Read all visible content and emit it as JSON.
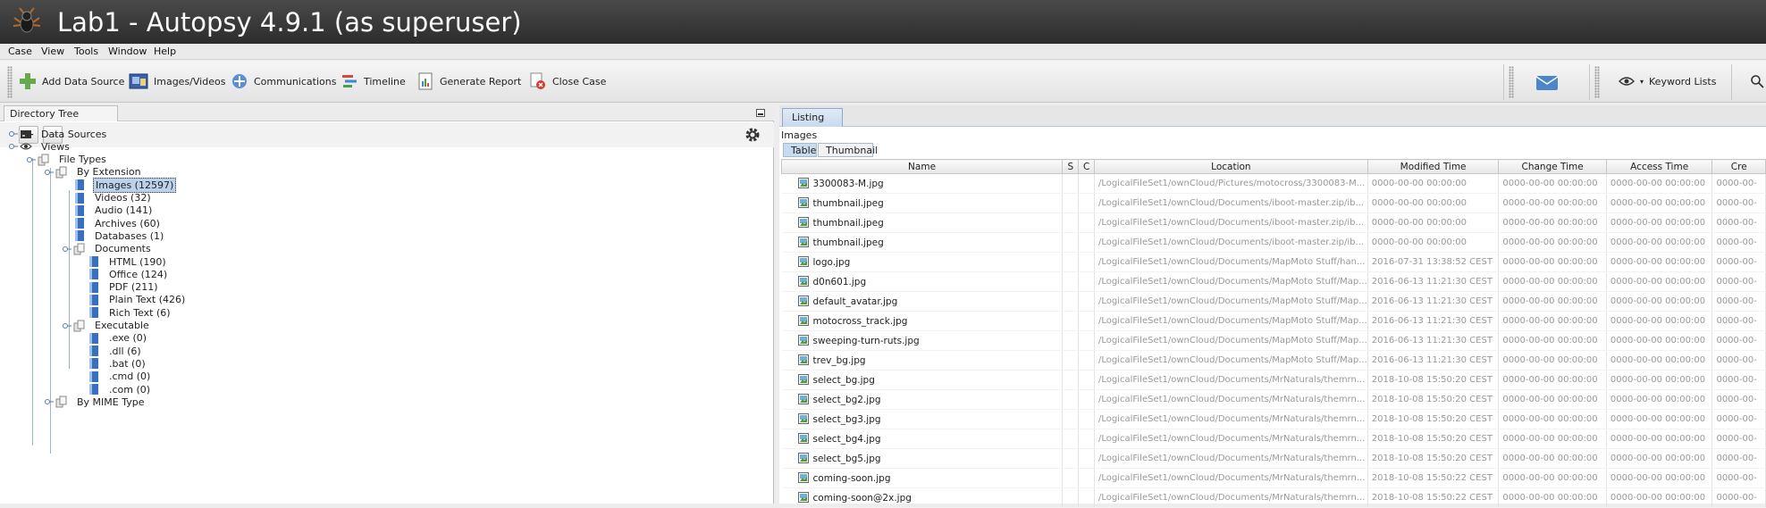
{
  "window": {
    "title": "Lab1 - Autopsy 4.9.1 (as superuser)"
  },
  "menubar": [
    "Case",
    "View",
    "Tools",
    "Window",
    "Help"
  ],
  "toolbar": {
    "add_data_source": "Add Data Source",
    "images_videos": "Images/Videos",
    "communications": "Communications",
    "timeline": "Timeline",
    "generate_report": "Generate Report",
    "close_case": "Close Case",
    "keyword_lists": "Keyword Lists"
  },
  "left_panel": {
    "tab": "Directory Tree",
    "tree": [
      {
        "label": "Data Sources",
        "depth": 0
      },
      {
        "label": "Views",
        "depth": 0
      },
      {
        "label": "File Types",
        "depth": 1
      },
      {
        "label": "By Extension",
        "depth": 2
      },
      {
        "label": "Images (12597)",
        "depth": 3,
        "selected": true
      },
      {
        "label": "Videos (32)",
        "depth": 3
      },
      {
        "label": "Audio (141)",
        "depth": 3
      },
      {
        "label": "Archives (60)",
        "depth": 3
      },
      {
        "label": "Databases (1)",
        "depth": 3
      },
      {
        "label": "Documents",
        "depth": 3
      },
      {
        "label": "HTML (190)",
        "depth": 4
      },
      {
        "label": "Office (124)",
        "depth": 4
      },
      {
        "label": "PDF (211)",
        "depth": 4
      },
      {
        "label": "Plain Text (426)",
        "depth": 4
      },
      {
        "label": "Rich Text (6)",
        "depth": 4
      },
      {
        "label": "Executable",
        "depth": 3
      },
      {
        "label": ".exe (0)",
        "depth": 4
      },
      {
        "label": ".dll (6)",
        "depth": 4
      },
      {
        "label": ".bat (0)",
        "depth": 4
      },
      {
        "label": ".cmd (0)",
        "depth": 4
      },
      {
        "label": ".com (0)",
        "depth": 4
      },
      {
        "label": "By MIME Type",
        "depth": 2
      }
    ]
  },
  "right_panel": {
    "tab": "Listing",
    "section_label": "Images",
    "subtabs": [
      "Table",
      "Thumbnail"
    ],
    "columns": [
      "Name",
      "S",
      "C",
      "Location",
      "Modified Time",
      "Change Time",
      "Access Time",
      "Cre"
    ],
    "rows": [
      {
        "name": "3300083-M.jpg",
        "location": "/LogicalFileSet1/ownCloud/Pictures/motocross/3300083-M...",
        "modified": "0000-00-00 00:00:00",
        "changed": "0000-00-00 00:00:00",
        "accessed": "0000-00-00 00:00:00",
        "created": "0000-00-"
      },
      {
        "name": "thumbnail.jpeg",
        "location": "/LogicalFileSet1/ownCloud/Documents/iboot-master.zip/ib...",
        "modified": "0000-00-00 00:00:00",
        "changed": "0000-00-00 00:00:00",
        "accessed": "0000-00-00 00:00:00",
        "created": "0000-00-"
      },
      {
        "name": "thumbnail.jpeg",
        "location": "/LogicalFileSet1/ownCloud/Documents/iboot-master.zip/ib...",
        "modified": "0000-00-00 00:00:00",
        "changed": "0000-00-00 00:00:00",
        "accessed": "0000-00-00 00:00:00",
        "created": "0000-00-"
      },
      {
        "name": "thumbnail.jpeg",
        "location": "/LogicalFileSet1/ownCloud/Documents/iboot-master.zip/ib...",
        "modified": "0000-00-00 00:00:00",
        "changed": "0000-00-00 00:00:00",
        "accessed": "0000-00-00 00:00:00",
        "created": "0000-00-"
      },
      {
        "name": "logo.jpg",
        "location": "/LogicalFileSet1/ownCloud/Documents/MapMoto Stuff/han...",
        "modified": "2016-07-31 13:38:52 CEST",
        "changed": "0000-00-00 00:00:00",
        "accessed": "0000-00-00 00:00:00",
        "created": "0000-00-"
      },
      {
        "name": "d0n601.jpg",
        "location": "/LogicalFileSet1/ownCloud/Documents/MapMoto Stuff/Map...",
        "modified": "2016-06-13 11:21:30 CEST",
        "changed": "0000-00-00 00:00:00",
        "accessed": "0000-00-00 00:00:00",
        "created": "0000-00-"
      },
      {
        "name": "default_avatar.jpg",
        "location": "/LogicalFileSet1/ownCloud/Documents/MapMoto Stuff/Map...",
        "modified": "2016-06-13 11:21:30 CEST",
        "changed": "0000-00-00 00:00:00",
        "accessed": "0000-00-00 00:00:00",
        "created": "0000-00-"
      },
      {
        "name": "motocross_track.jpg",
        "location": "/LogicalFileSet1/ownCloud/Documents/MapMoto Stuff/Map...",
        "modified": "2016-06-13 11:21:30 CEST",
        "changed": "0000-00-00 00:00:00",
        "accessed": "0000-00-00 00:00:00",
        "created": "0000-00-"
      },
      {
        "name": "sweeping-turn-ruts.jpg",
        "location": "/LogicalFileSet1/ownCloud/Documents/MapMoto Stuff/Map...",
        "modified": "2016-06-13 11:21:30 CEST",
        "changed": "0000-00-00 00:00:00",
        "accessed": "0000-00-00 00:00:00",
        "created": "0000-00-"
      },
      {
        "name": "trev_bg.jpg",
        "location": "/LogicalFileSet1/ownCloud/Documents/MapMoto Stuff/Map...",
        "modified": "2016-06-13 11:21:30 CEST",
        "changed": "0000-00-00 00:00:00",
        "accessed": "0000-00-00 00:00:00",
        "created": "0000-00-"
      },
      {
        "name": "select_bg.jpg",
        "location": "/LogicalFileSet1/ownCloud/Documents/MrNaturals/themrn...",
        "modified": "2018-10-08 15:50:20 CEST",
        "changed": "0000-00-00 00:00:00",
        "accessed": "0000-00-00 00:00:00",
        "created": "0000-00-"
      },
      {
        "name": "select_bg2.jpg",
        "location": "/LogicalFileSet1/ownCloud/Documents/MrNaturals/themrn...",
        "modified": "2018-10-08 15:50:20 CEST",
        "changed": "0000-00-00 00:00:00",
        "accessed": "0000-00-00 00:00:00",
        "created": "0000-00-"
      },
      {
        "name": "select_bg3.jpg",
        "location": "/LogicalFileSet1/ownCloud/Documents/MrNaturals/themrn...",
        "modified": "2018-10-08 15:50:20 CEST",
        "changed": "0000-00-00 00:00:00",
        "accessed": "0000-00-00 00:00:00",
        "created": "0000-00-"
      },
      {
        "name": "select_bg4.jpg",
        "location": "/LogicalFileSet1/ownCloud/Documents/MrNaturals/themrn...",
        "modified": "2018-10-08 15:50:20 CEST",
        "changed": "0000-00-00 00:00:00",
        "accessed": "0000-00-00 00:00:00",
        "created": "0000-00-"
      },
      {
        "name": "select_bg5.jpg",
        "location": "/LogicalFileSet1/ownCloud/Documents/MrNaturals/themrn...",
        "modified": "2018-10-08 15:50:20 CEST",
        "changed": "0000-00-00 00:00:00",
        "accessed": "0000-00-00 00:00:00",
        "created": "0000-00-"
      },
      {
        "name": "coming-soon.jpg",
        "location": "/LogicalFileSet1/ownCloud/Documents/MrNaturals/themrn...",
        "modified": "2018-10-08 15:50:22 CEST",
        "changed": "0000-00-00 00:00:00",
        "accessed": "0000-00-00 00:00:00",
        "created": "0000-00-"
      },
      {
        "name": "coming-soon@2x.jpg",
        "location": "/LogicalFileSet1/ownCloud/Documents/MrNaturals/themrn...",
        "modified": "2018-10-08 15:50:22 CEST",
        "changed": "0000-00-00 00:00:00",
        "accessed": "0000-00-00 00:00:00",
        "created": "0000-00-"
      }
    ]
  }
}
